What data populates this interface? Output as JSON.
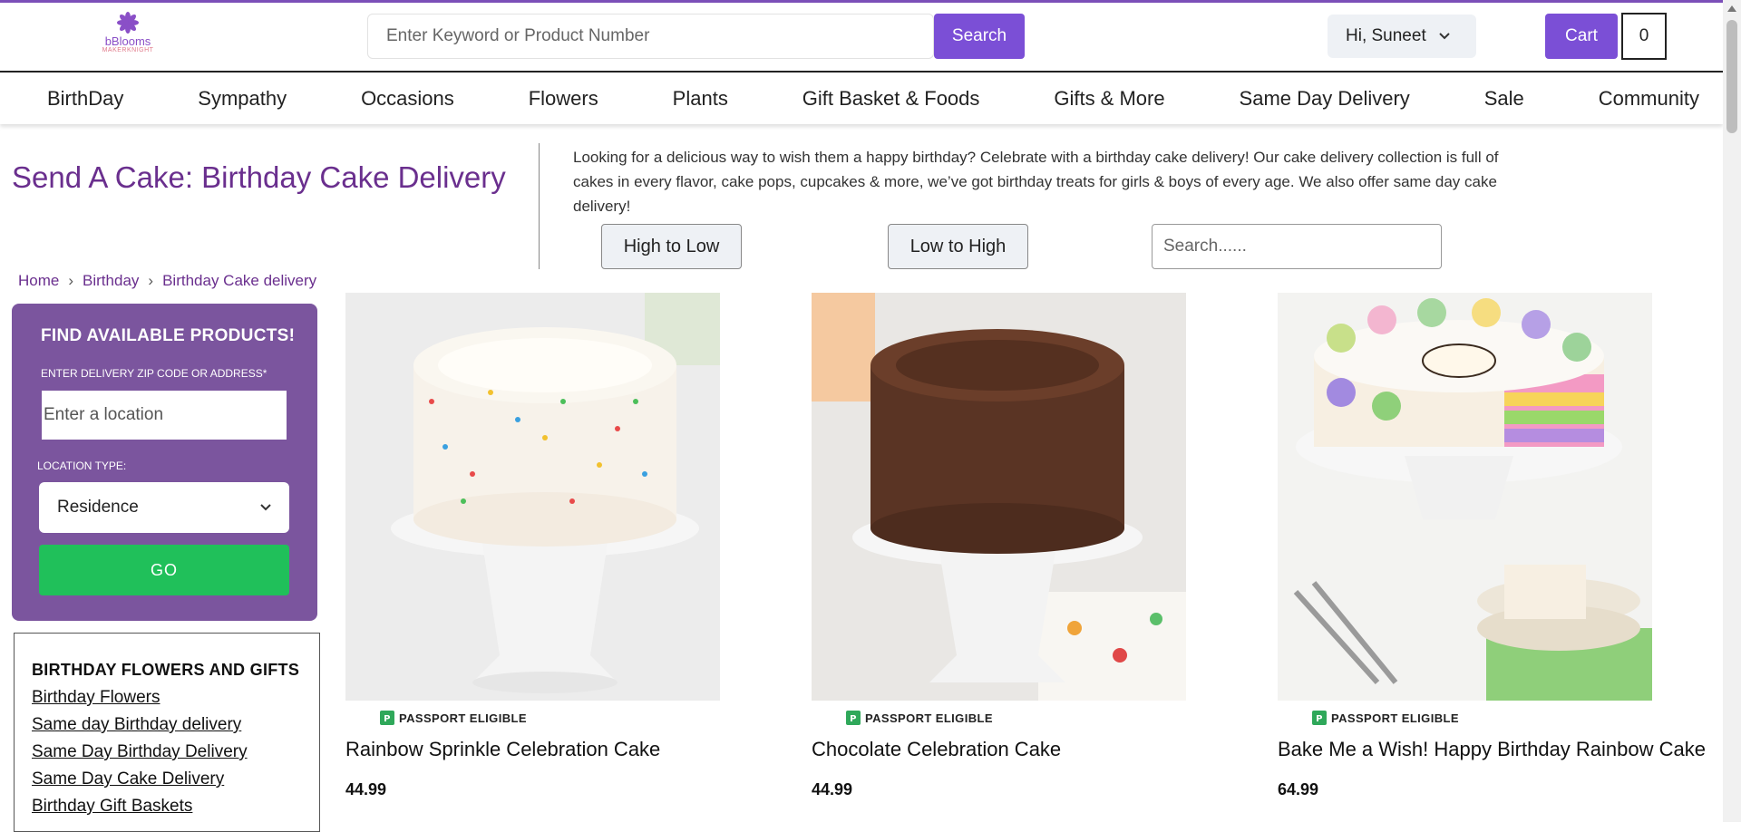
{
  "header": {
    "logo": {
      "brand": "bBlooms",
      "sub": "MAKERKNIGHT"
    },
    "search_placeholder": "Enter Keyword or Product Number",
    "search_button": "Search",
    "account_label": "Hi, Suneet",
    "cart_label": "Cart",
    "cart_count": "0"
  },
  "nav": [
    "BirthDay",
    "Sympathy",
    "Occasions",
    "Flowers",
    "Plants",
    "Gift Basket & Foods",
    "Gifts & More",
    "Same Day Delivery",
    "Sale",
    "Community"
  ],
  "page": {
    "title": "Send A Cake: Birthday Cake Delivery",
    "intro": "Looking for a delicious way to wish them a happy birthday? Celebrate with a birthday cake delivery! Our cake delivery collection is full of cakes in every flavor, cake pops, cupcakes & more, we’ve got birthday treats for girls & boys of every age. We also offer same day cake delivery!",
    "sort_high": "High to Low",
    "sort_low": "Low to High",
    "list_search_placeholder": "Search......"
  },
  "breadcrumb": [
    "Home",
    "Birthday",
    "Birthday Cake delivery"
  ],
  "finder": {
    "title": "FIND AVAILABLE PRODUCTS!",
    "zip_label": "ENTER DELIVERY ZIP CODE OR ADDRESS*",
    "zip_placeholder": "Enter a location",
    "type_label": "LOCATION TYPE:",
    "type_value": "Residence",
    "go": "GO"
  },
  "links": {
    "title": "BIRTHDAY FLOWERS AND GIFTS",
    "items": [
      "Birthday Flowers",
      "Same day Birthday delivery",
      "Same Day Birthday Delivery",
      "Same Day Cake Delivery",
      "Birthday Gift Baskets"
    ]
  },
  "products": [
    {
      "badge": "PASSPORT ELIGIBLE",
      "name": "Rainbow Sprinkle Celebration Cake",
      "price": "44.99"
    },
    {
      "badge": "PASSPORT ELIGIBLE",
      "name": "Chocolate Celebration Cake",
      "price": "44.99"
    },
    {
      "badge": "PASSPORT ELIGIBLE",
      "name": "Bake Me a Wish! Happy Birthday Rainbow Cake",
      "price": "64.99"
    }
  ],
  "colors": {
    "brand_purple": "#7b4fd6",
    "title_purple": "#6a2f8e",
    "finder_bg": "#7b559e",
    "go_green": "#20c05a"
  }
}
